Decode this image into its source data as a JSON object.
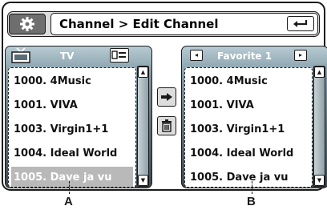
{
  "header": {
    "breadcrumb": "Channel > Edit Channel"
  },
  "icons": {
    "settings": "gear-icon",
    "back": "return-arrow-icon",
    "tv": "tv-icon",
    "epg": "guide-icon",
    "move": "arrow-right-icon",
    "delete": "trash-icon"
  },
  "left_panel": {
    "title": "TV",
    "items": [
      "1000. 4Music",
      "1001. VIVA",
      "1003. Virgin1+1",
      "1004. Ideal World",
      "1005. Dave ja vu"
    ],
    "selected_index": 4
  },
  "right_panel": {
    "title": "Favorite 1",
    "prev_glyph": "◂",
    "next_glyph": "▸",
    "items": [
      "1000. 4Music",
      "1001. VIVA",
      "1003. Virgin1+1",
      "1004. Ideal World",
      "1005. Dave ja vu"
    ]
  },
  "scroll_glyphs": {
    "up": "▲",
    "down": "▼"
  },
  "callouts": {
    "left": "A",
    "right": "B"
  },
  "colors": {
    "selection": "#b9b9b9",
    "panel_gradient_top": "#b7cbd3",
    "panel_gradient_bottom": "#3e4a50"
  }
}
